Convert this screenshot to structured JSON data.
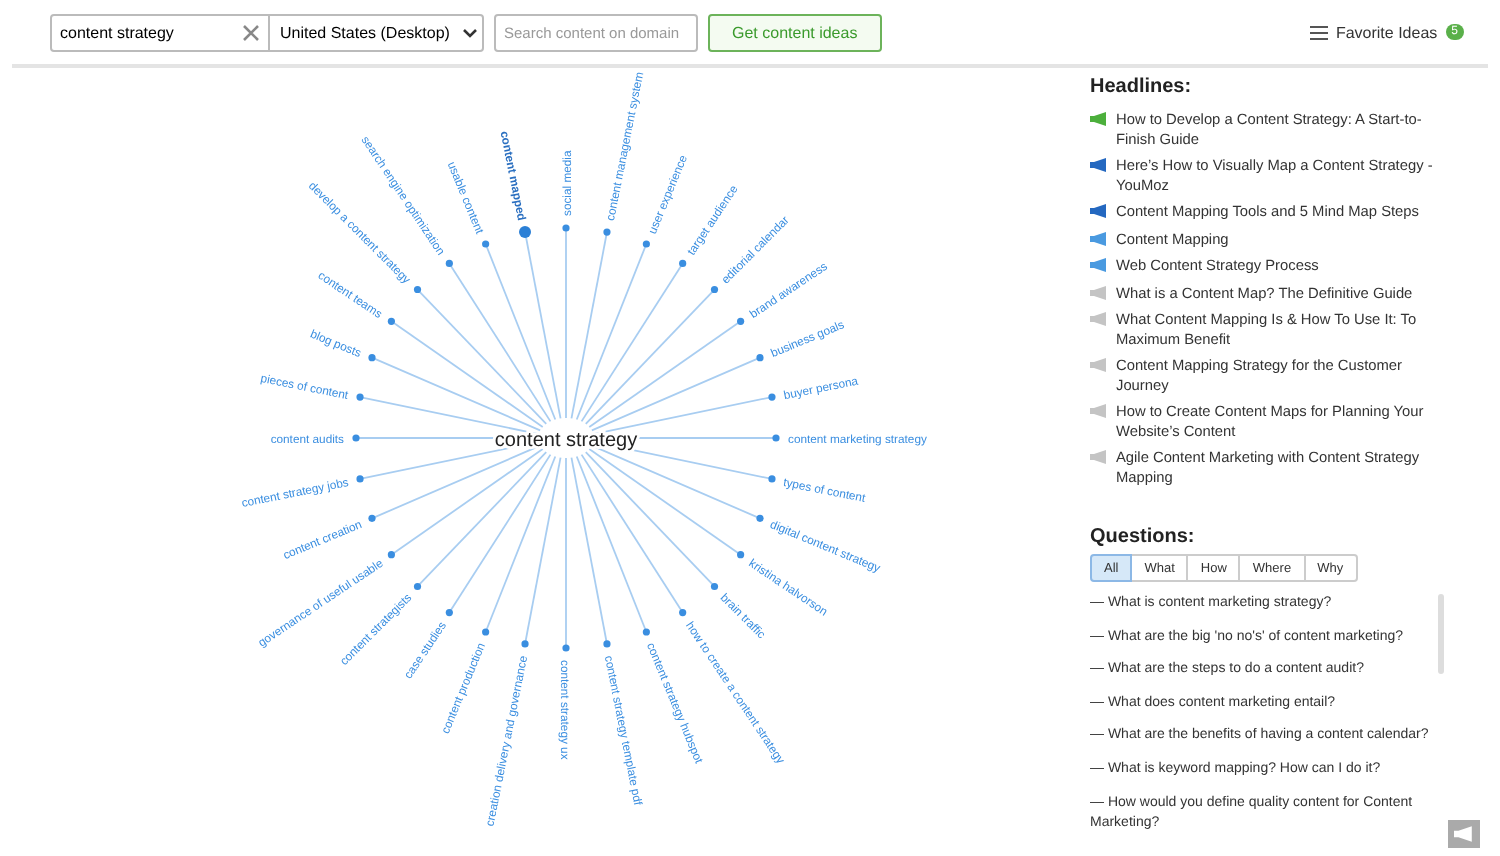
{
  "search": {
    "value": "content strategy"
  },
  "location": {
    "value": "United States (Desktop)"
  },
  "domain_search": {
    "placeholder": "Search content on domain"
  },
  "get_ideas_button": "Get content ideas",
  "favorites": {
    "label": "Favorite Ideas",
    "count": "5"
  },
  "mind_map": {
    "center": "content strategy",
    "nodes": [
      {
        "label": "content audits",
        "selected": false
      },
      {
        "label": "pieces of content",
        "selected": false
      },
      {
        "label": "blog posts",
        "selected": false
      },
      {
        "label": "content teams",
        "selected": false
      },
      {
        "label": "develop a content strategy",
        "selected": false
      },
      {
        "label": "search engine optimization",
        "selected": false
      },
      {
        "label": "usable content",
        "selected": false
      },
      {
        "label": "content mapped",
        "selected": true
      },
      {
        "label": "social media",
        "selected": false
      },
      {
        "label": "content management system",
        "selected": false
      },
      {
        "label": "user experience",
        "selected": false
      },
      {
        "label": "target audience",
        "selected": false
      },
      {
        "label": "editorial calendar",
        "selected": false
      },
      {
        "label": "brand awareness",
        "selected": false
      },
      {
        "label": "business goals",
        "selected": false
      },
      {
        "label": "buyer persona",
        "selected": false
      },
      {
        "label": "content marketing strategy",
        "selected": false
      },
      {
        "label": "types of content",
        "selected": false
      },
      {
        "label": "digital content strategy",
        "selected": false
      },
      {
        "label": "kristina halvorson",
        "selected": false
      },
      {
        "label": "brain traffic",
        "selected": false
      },
      {
        "label": "how to create a content strategy",
        "selected": false
      },
      {
        "label": "content strategy hubspot",
        "selected": false
      },
      {
        "label": "content strategy template pdf",
        "selected": false
      },
      {
        "label": "content strategy ux",
        "selected": false
      },
      {
        "label": "creation delivery and governance",
        "selected": false
      },
      {
        "label": "content production",
        "selected": false
      },
      {
        "label": "case studies",
        "selected": false
      },
      {
        "label": "content strategists",
        "selected": false
      },
      {
        "label": "governance of useful usable",
        "selected": false
      },
      {
        "label": "content creation",
        "selected": false
      },
      {
        "label": "content strategy jobs",
        "selected": false
      }
    ]
  },
  "headlines": {
    "title": "Headlines:",
    "items": [
      {
        "text": "How to Develop a Content Strategy: A Start-to-Finish Guide",
        "color": "#4caf3c"
      },
      {
        "text": "Here’s How to Visually Map a Content Strategy - YouMoz",
        "color": "#2468c0"
      },
      {
        "text": "Content Mapping Tools and 5 Mind Map Steps",
        "color": "#2468c0"
      },
      {
        "text": "Content Mapping",
        "color": "#4a9ae0"
      },
      {
        "text": "Web Content Strategy Process",
        "color": "#4a9ae0"
      },
      {
        "text": "What is a Content Map? The Definitive Guide",
        "color": "#c4c4c4"
      },
      {
        "text": "What Content Mapping Is & How To Use It: To Maximum Benefit",
        "color": "#c4c4c4"
      },
      {
        "text": "Content Mapping Strategy for the Customer Journey",
        "color": "#c4c4c4"
      },
      {
        "text": "How to Create Content Maps for Planning Your Website’s Content",
        "color": "#c4c4c4"
      },
      {
        "text": "Agile Content Marketing with Content Strategy Mapping",
        "color": "#c4c4c4"
      }
    ]
  },
  "questions": {
    "title": "Questions:",
    "filters": [
      {
        "label": "All",
        "selected": true
      },
      {
        "label": "What",
        "selected": false
      },
      {
        "label": "How",
        "selected": false
      },
      {
        "label": "Where",
        "selected": false
      },
      {
        "label": "Why",
        "selected": false
      }
    ],
    "items": [
      "— What is content marketing strategy?",
      "— What are the big 'no no's' of content marketing?",
      "— What are the steps to do a content audit?",
      "— What does content marketing entail?",
      "— What are the benefits of having a content calendar?",
      "— What is keyword mapping? How can I do it?",
      "— How would you define quality content for Content Marketing?"
    ]
  }
}
